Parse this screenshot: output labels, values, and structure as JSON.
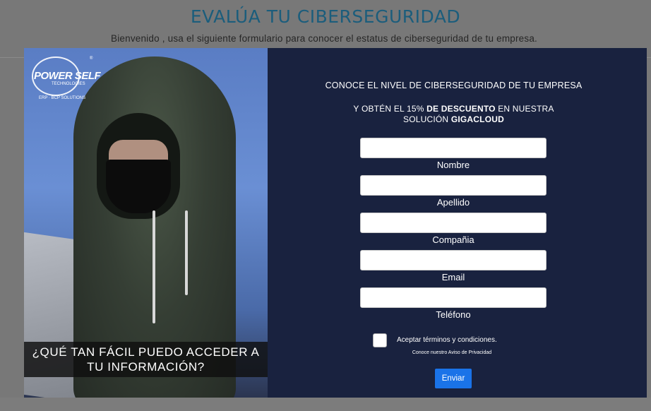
{
  "page": {
    "title": "EVALÚA TU CIBERSEGURIDAD",
    "subtitle": "Bienvenido , usa el siguiente formulario para conocer el estatus de ciberseguridad de tu empresa."
  },
  "hero": {
    "logo_main": "POWER SELF",
    "logo_sub": "TECHNOLOGIES",
    "logo_tag": "ERP · BCP SOLUTIONS",
    "logo_reg": "®",
    "caption_line1": "¿QUÉ TAN FÁCIL PUEDO ACCEDER A",
    "caption_line2": "TU INFORMACIÓN?"
  },
  "form": {
    "headline": "CONOCE EL NIVEL DE CIBERSEGURIDAD DE TU EMPRESA",
    "promo_part1": "Y OBTÉN EL 15% ",
    "promo_bold1": "DE DESCUENTO",
    "promo_part2": " EN NUESTRA",
    "promo_part3": "SOLUCIÓN ",
    "promo_bold2": "GIGACLOUD",
    "fields": [
      {
        "label": "Nombre",
        "value": ""
      },
      {
        "label": "Apellido",
        "value": ""
      },
      {
        "label": "Compañia",
        "value": ""
      },
      {
        "label": "Email",
        "value": ""
      },
      {
        "label": "Teléfono",
        "value": ""
      }
    ],
    "terms_label": "Aceptar términos y condiciones.",
    "terms_checked": false,
    "privacy_link": "Conoce nuestro Aviso de Privacidad",
    "submit_label": "Enviar"
  },
  "colors": {
    "modal_bg": "#19223f",
    "title_color": "#1b5d7c",
    "submit_bg": "#1a73e8",
    "backdrop": "#787878"
  }
}
